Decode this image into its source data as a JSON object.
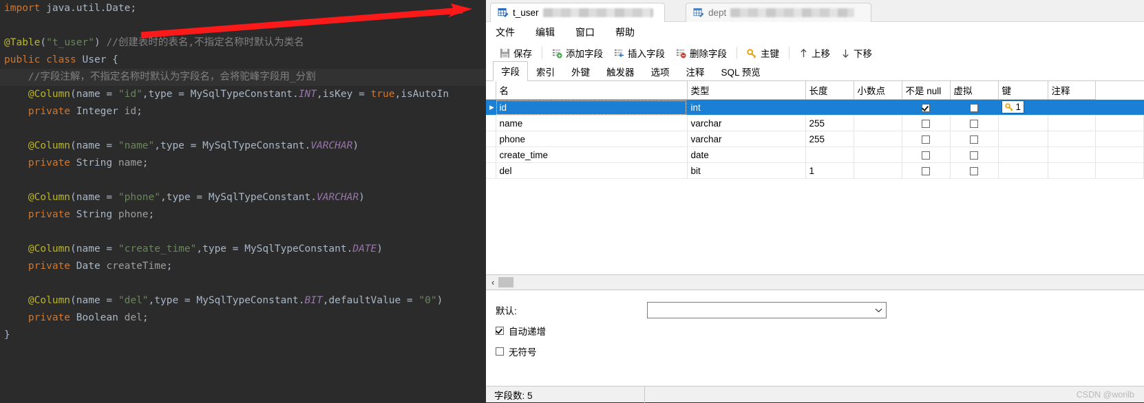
{
  "editor": {
    "language": "java",
    "background": "#2b2b2b",
    "lines": [
      {
        "highlight": false,
        "tokens": [
          {
            "t": "import ",
            "c": "kw"
          },
          {
            "t": "java.util.Date;",
            "c": "plain"
          }
        ]
      },
      {
        "highlight": false,
        "tokens": []
      },
      {
        "highlight": false,
        "tokens": [
          {
            "t": "@Table",
            "c": "anno"
          },
          {
            "t": "(",
            "c": "plain"
          },
          {
            "t": "\"t_user\"",
            "c": "str"
          },
          {
            "t": ") ",
            "c": "plain"
          },
          {
            "t": "//创建表时的表名,不指定名称时默认为类名",
            "c": "cmt"
          }
        ]
      },
      {
        "highlight": false,
        "tokens": [
          {
            "t": "public class ",
            "c": "kw"
          },
          {
            "t": "User ",
            "c": "typ"
          },
          {
            "t": "{",
            "c": "plain"
          }
        ]
      },
      {
        "highlight": true,
        "tokens": [
          {
            "t": "    //字段注解，不指定名称时默认为字段名，会将驼峰字段用_分割",
            "c": "cmt"
          }
        ]
      },
      {
        "highlight": false,
        "tokens": [
          {
            "t": "    ",
            "c": "plain"
          },
          {
            "t": "@Column",
            "c": "anno"
          },
          {
            "t": "(name = ",
            "c": "plain"
          },
          {
            "t": "\"id\"",
            "c": "str"
          },
          {
            "t": ",type = MySqlTypeConstant.",
            "c": "plain"
          },
          {
            "t": "INT",
            "c": "const"
          },
          {
            "t": ",isKey = ",
            "c": "plain"
          },
          {
            "t": "true",
            "c": "kw"
          },
          {
            "t": ",isAutoIn",
            "c": "plain"
          }
        ]
      },
      {
        "highlight": false,
        "tokens": [
          {
            "t": "    ",
            "c": "plain"
          },
          {
            "t": "private ",
            "c": "kw"
          },
          {
            "t": "Integer ",
            "c": "typ"
          },
          {
            "t": "id",
            "c": "fld"
          },
          {
            "t": ";",
            "c": "plain"
          }
        ]
      },
      {
        "highlight": false,
        "tokens": []
      },
      {
        "highlight": false,
        "tokens": [
          {
            "t": "    ",
            "c": "plain"
          },
          {
            "t": "@Column",
            "c": "anno"
          },
          {
            "t": "(name = ",
            "c": "plain"
          },
          {
            "t": "\"name\"",
            "c": "str"
          },
          {
            "t": ",type = MySqlTypeConstant.",
            "c": "plain"
          },
          {
            "t": "VARCHAR",
            "c": "const"
          },
          {
            "t": ")",
            "c": "plain"
          }
        ]
      },
      {
        "highlight": false,
        "tokens": [
          {
            "t": "    ",
            "c": "plain"
          },
          {
            "t": "private ",
            "c": "kw"
          },
          {
            "t": "String ",
            "c": "typ"
          },
          {
            "t": "name",
            "c": "fld"
          },
          {
            "t": ";",
            "c": "plain"
          }
        ]
      },
      {
        "highlight": false,
        "tokens": []
      },
      {
        "highlight": false,
        "tokens": [
          {
            "t": "    ",
            "c": "plain"
          },
          {
            "t": "@Column",
            "c": "anno"
          },
          {
            "t": "(name = ",
            "c": "plain"
          },
          {
            "t": "\"phone\"",
            "c": "str"
          },
          {
            "t": ",type = MySqlTypeConstant.",
            "c": "plain"
          },
          {
            "t": "VARCHAR",
            "c": "const"
          },
          {
            "t": ")",
            "c": "plain"
          }
        ]
      },
      {
        "highlight": false,
        "tokens": [
          {
            "t": "    ",
            "c": "plain"
          },
          {
            "t": "private ",
            "c": "kw"
          },
          {
            "t": "String ",
            "c": "typ"
          },
          {
            "t": "phone",
            "c": "fld"
          },
          {
            "t": ";",
            "c": "plain"
          }
        ]
      },
      {
        "highlight": false,
        "tokens": []
      },
      {
        "highlight": false,
        "tokens": [
          {
            "t": "    ",
            "c": "plain"
          },
          {
            "t": "@Column",
            "c": "anno"
          },
          {
            "t": "(name = ",
            "c": "plain"
          },
          {
            "t": "\"create_time\"",
            "c": "str"
          },
          {
            "t": ",type = MySqlTypeConstant.",
            "c": "plain"
          },
          {
            "t": "DATE",
            "c": "const"
          },
          {
            "t": ")",
            "c": "plain"
          }
        ]
      },
      {
        "highlight": false,
        "tokens": [
          {
            "t": "    ",
            "c": "plain"
          },
          {
            "t": "private ",
            "c": "kw"
          },
          {
            "t": "Date ",
            "c": "typ"
          },
          {
            "t": "createTime",
            "c": "fld"
          },
          {
            "t": ";",
            "c": "plain"
          }
        ]
      },
      {
        "highlight": false,
        "tokens": []
      },
      {
        "highlight": false,
        "tokens": [
          {
            "t": "    ",
            "c": "plain"
          },
          {
            "t": "@Column",
            "c": "anno"
          },
          {
            "t": "(name = ",
            "c": "plain"
          },
          {
            "t": "\"del\"",
            "c": "str"
          },
          {
            "t": ",type = MySqlTypeConstant.",
            "c": "plain"
          },
          {
            "t": "BIT",
            "c": "const"
          },
          {
            "t": ",defaultValue = ",
            "c": "plain"
          },
          {
            "t": "\"0\"",
            "c": "str"
          },
          {
            "t": ")",
            "c": "plain"
          }
        ]
      },
      {
        "highlight": false,
        "tokens": [
          {
            "t": "    ",
            "c": "plain"
          },
          {
            "t": "private ",
            "c": "kw"
          },
          {
            "t": "Boolean ",
            "c": "typ"
          },
          {
            "t": "del",
            "c": "fld"
          },
          {
            "t": ";",
            "c": "plain"
          }
        ]
      },
      {
        "highlight": false,
        "tokens": [
          {
            "t": "}",
            "c": "plain"
          }
        ]
      }
    ],
    "annotation": {
      "shape": "arrow",
      "color": "#fb1a1a"
    }
  },
  "app": {
    "window_tabs": [
      {
        "label": "t_user",
        "icon": "table-design-icon",
        "active": true,
        "blurred_suffix": true
      },
      {
        "label": "dept",
        "icon": "table-design-icon",
        "active": false,
        "blurred_suffix": true
      }
    ],
    "menubar": [
      {
        "label": "文件"
      },
      {
        "label": "编辑"
      },
      {
        "label": "窗口"
      },
      {
        "label": "帮助"
      }
    ],
    "toolbar": [
      {
        "label": "保存",
        "icon": "save-icon"
      },
      {
        "sep": true
      },
      {
        "label": "添加字段",
        "icon": "add-field-icon"
      },
      {
        "label": "插入字段",
        "icon": "insert-field-icon"
      },
      {
        "label": "删除字段",
        "icon": "delete-field-icon"
      },
      {
        "sep": true
      },
      {
        "label": "主键",
        "icon": "key-icon"
      },
      {
        "sep": true
      },
      {
        "label": "上移",
        "icon": "arrow-up-icon"
      },
      {
        "label": "下移",
        "icon": "arrow-down-icon"
      }
    ],
    "object_tabs": [
      {
        "label": "字段",
        "selected": true
      },
      {
        "label": "索引",
        "selected": false
      },
      {
        "label": "外键",
        "selected": false
      },
      {
        "label": "触发器",
        "selected": false
      },
      {
        "label": "选项",
        "selected": false
      },
      {
        "label": "注释",
        "selected": false
      },
      {
        "label": "SQL 预览",
        "selected": false
      }
    ],
    "grid": {
      "columns": [
        "名",
        "类型",
        "长度",
        "小数点",
        "不是 null",
        "虚拟",
        "键",
        "注释"
      ],
      "rows": [
        {
          "marker": "▸",
          "selected": true,
          "name": "id",
          "type": "int",
          "length": "",
          "decimals": "",
          "not_null": true,
          "virtual": false,
          "key": "1",
          "comment": ""
        },
        {
          "marker": "",
          "selected": false,
          "name": "name",
          "type": "varchar",
          "length": "255",
          "decimals": "",
          "not_null": false,
          "virtual": false,
          "key": "",
          "comment": ""
        },
        {
          "marker": "",
          "selected": false,
          "name": "phone",
          "type": "varchar",
          "length": "255",
          "decimals": "",
          "not_null": false,
          "virtual": false,
          "key": "",
          "comment": ""
        },
        {
          "marker": "",
          "selected": false,
          "name": "create_time",
          "type": "date",
          "length": "",
          "decimals": "",
          "not_null": false,
          "virtual": false,
          "key": "",
          "comment": ""
        },
        {
          "marker": "",
          "selected": false,
          "name": "del",
          "type": "bit",
          "length": "1",
          "decimals": "",
          "not_null": false,
          "virtual": false,
          "key": "",
          "comment": ""
        }
      ],
      "selection_accent": "#1b7fd4"
    },
    "detail": {
      "default_label": "默认:",
      "default_value": "",
      "auto_increment": {
        "label": "自动递增",
        "checked": true
      },
      "unsigned": {
        "label": "无符号",
        "checked": false
      }
    },
    "status": {
      "field_count": "字段数: 5",
      "watermark": "CSDN @worilb"
    }
  }
}
